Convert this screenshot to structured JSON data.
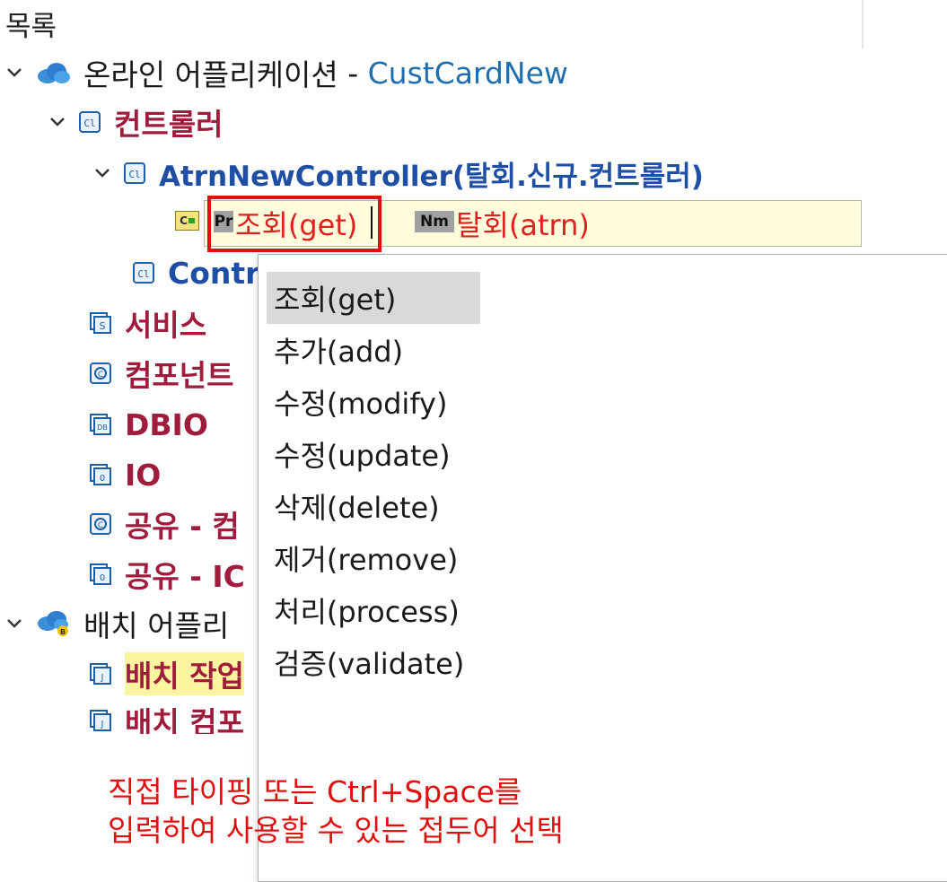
{
  "panel": {
    "title": "목록"
  },
  "tree": {
    "online_app": {
      "label": "온라인 어플리케이션",
      "sep": " - ",
      "sub": "CustCardNew",
      "icon": "cloud-icon"
    },
    "controller_folder": {
      "label": "컨트롤러",
      "icon": "controller-icon"
    },
    "atrn_controller": {
      "label": "AtrnNewController(탈회.신규.컨트롤러)",
      "icon": "controller-icon"
    },
    "contr_item": {
      "label": "Contr",
      "icon": "controller-icon"
    },
    "service": {
      "label": "서비스",
      "icon": "service-icon"
    },
    "component": {
      "label": "컴포넌트",
      "icon": "component-icon"
    },
    "dbio": {
      "label": "DBIO",
      "icon": "dbio-icon"
    },
    "io": {
      "label": "IO",
      "icon": "io-icon"
    },
    "shared_comp": {
      "label": "공유 - 컴",
      "icon": "component-icon"
    },
    "shared_io": {
      "label": "공유 - IC",
      "icon": "io-icon"
    },
    "batch_app": {
      "label": "배치 어플리",
      "icon": "batch-cloud-icon"
    },
    "batch_job": {
      "label": "배치 작업",
      "icon": "job-icon"
    },
    "batch_comp": {
      "label": "배치 컴포",
      "icon": "job-icon"
    }
  },
  "editor": {
    "badge": "C",
    "prefix_tag": "Pr",
    "prefix_value": "조회(get)",
    "name_tag": "Nm",
    "name_value": "탈회(atrn)"
  },
  "dropdown": {
    "items": [
      {
        "label": "조회(get)",
        "selected": true
      },
      {
        "label": "추가(add)",
        "selected": false
      },
      {
        "label": "수정(modify)",
        "selected": false
      },
      {
        "label": "수정(update)",
        "selected": false
      },
      {
        "label": "삭제(delete)",
        "selected": false
      },
      {
        "label": "제거(remove)",
        "selected": false
      },
      {
        "label": "처리(process)",
        "selected": false
      },
      {
        "label": "검증(validate)",
        "selected": false
      }
    ]
  },
  "note": {
    "line1": "직접 타이핑 또는 Ctrl+Space를",
    "line2": "입력하여 사용할 수 있는 접두어 선택"
  },
  "colors": {
    "red_label": "#a01c3c",
    "blue_label": "#1f4fa5",
    "accent_red": "#e01010",
    "editor_bg": "#fffddc",
    "highlight_yellow": "#fbf5a0",
    "selected_bg": "#d9d9d9"
  }
}
